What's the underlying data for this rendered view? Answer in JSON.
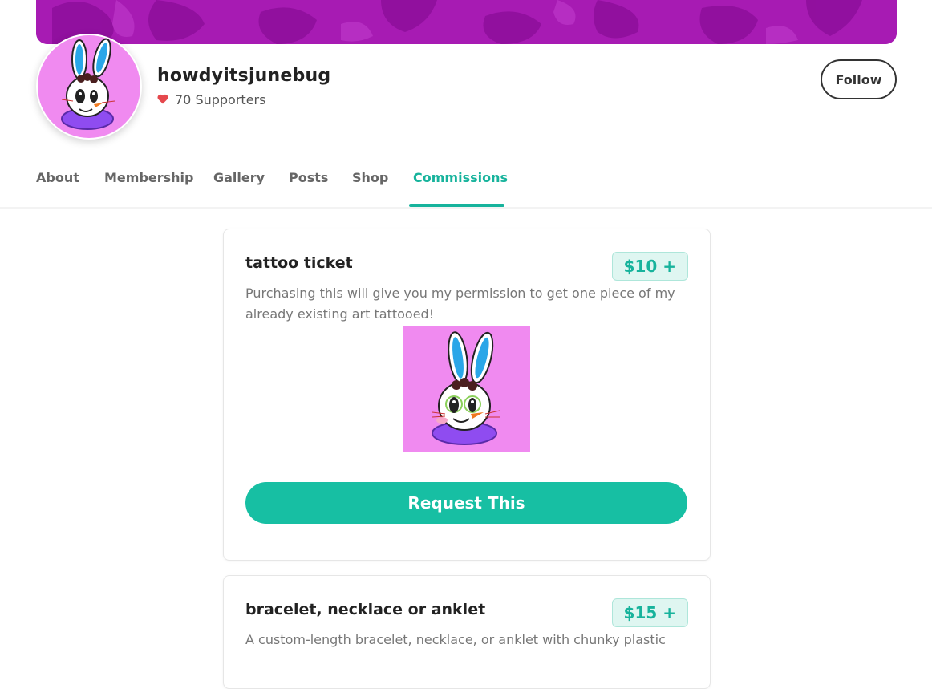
{
  "profile": {
    "username": "howdyitsjunebug",
    "supporters_text": "70 Supporters",
    "follow_label": "Follow"
  },
  "nav": {
    "tabs": [
      {
        "label": "About"
      },
      {
        "label": "Membership"
      },
      {
        "label": "Gallery"
      },
      {
        "label": "Posts"
      },
      {
        "label": "Shop"
      },
      {
        "label": "Commissions"
      }
    ],
    "active_tab": "Commissions"
  },
  "commissions": [
    {
      "title": "tattoo ticket",
      "price": "$10 +",
      "description": "Purchasing this will give you my permission to get one piece of my already existing art tattooed!",
      "button_label": "Request This"
    },
    {
      "title": "bracelet, necklace or anklet",
      "price": "$15 +",
      "description": "A custom-length bracelet, necklace, or anklet with chunky plastic"
    }
  ],
  "colors": {
    "accent": "#17bfa3",
    "banner": "#a71bb3",
    "heart": "#e5484d"
  },
  "icons": {
    "heart": "heart-icon"
  }
}
